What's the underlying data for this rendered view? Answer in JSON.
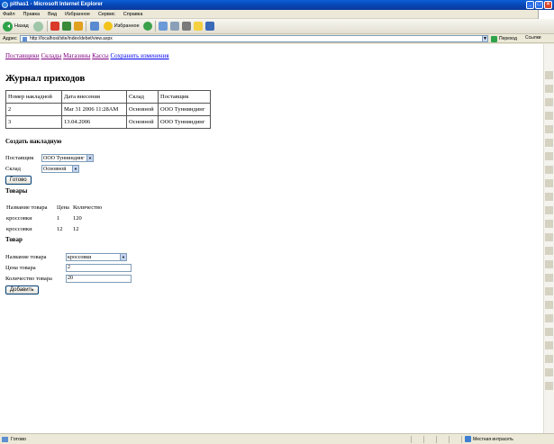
{
  "window": {
    "title": "pithas1 - Microsoft Internet Explorer",
    "buttons": [
      "_",
      "□",
      "×"
    ]
  },
  "menu": [
    "Файл",
    "Правка",
    "Вид",
    "Избранное",
    "Сервис",
    "Справка"
  ],
  "toolbar": {
    "back_label": "Назад",
    "favorites_label": "Избранное"
  },
  "address": {
    "label": "Адрес",
    "url": "http://localhost/site/index/debet/view.aspx",
    "go_label": "Переход",
    "links_label": "Ссылки"
  },
  "status": {
    "text": "Готово",
    "zone": "Местная интрасеть"
  },
  "page": {
    "nav": [
      {
        "label": "Поставщики",
        "visited": true
      },
      {
        "label": "Склады",
        "visited": true
      },
      {
        "label": "Магазины",
        "visited": true
      },
      {
        "label": "Кассы",
        "visited": true
      },
      {
        "label": "Сохранить изменения",
        "visited": false
      }
    ],
    "title": "Журнал приходов",
    "journal": {
      "headers": [
        "Номер накладной",
        "Дата внесения",
        "Склад",
        "Поставщик"
      ],
      "rows": [
        [
          "2",
          "Mar 31 2006 11:28AM",
          "Основной",
          "ООО Тунниндинг"
        ],
        [
          "3",
          "13.04.2006",
          "Основной",
          "ООО Тунниндинг"
        ]
      ]
    },
    "create_heading": "Создать накладную",
    "create_form": {
      "supplier_label": "Поставщик",
      "supplier_value": "ООО Тунниндинг",
      "warehouse_label": "Склад",
      "warehouse_value": "Основной",
      "submit_label": "Готово"
    },
    "goods_heading": "Товары",
    "goods": {
      "headers": [
        "Название товара",
        "Цена",
        "Количество"
      ],
      "rows": [
        [
          "кроссовки",
          "1",
          "120"
        ],
        [
          "кроссовки",
          "12",
          "12"
        ]
      ]
    },
    "item_heading": "Товар",
    "item_form": {
      "name_label": "Название товара",
      "name_value": "кроссовки",
      "price_label": "Цена товара",
      "price_value": "2",
      "qty_label": "Количество товара",
      "qty_value": "20",
      "add_label": "Добавить"
    }
  }
}
